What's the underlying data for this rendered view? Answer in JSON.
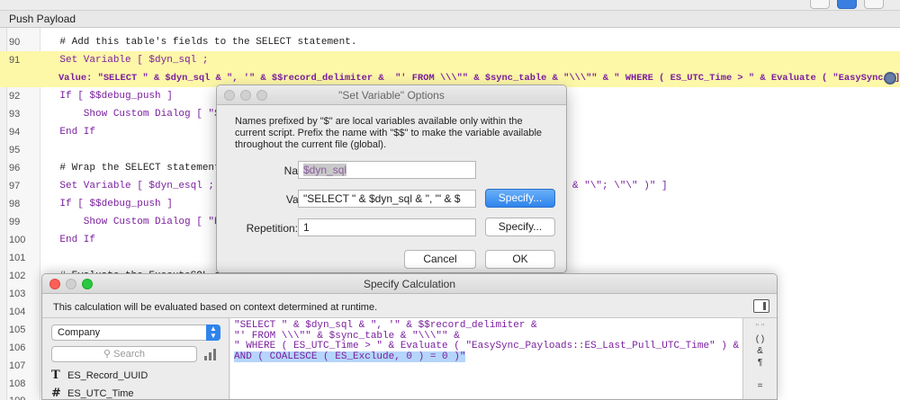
{
  "window": {
    "tab_title": "Push Payload"
  },
  "script_lines": [
    {
      "num": "90",
      "text": "    # Add this table's fields to the SELECT statement.",
      "kind": "comment"
    },
    {
      "num": "91",
      "text": "    Set Variable [ $dyn_sql ;",
      "kind": "step",
      "highlight": true
    },
    {
      "num": "",
      "text": "    Value: \"SELECT \" & $dyn_sql & \", '\" & $$record_delimiter &  \"' FROM \\\\\\\"\" & $sync_table & \"\\\\\\\"\" & \" WHERE ( ES_UTC_Time > \" & Evaluate ( \"EasySync… ]",
      "kind": "step",
      "highlight": true
    },
    {
      "num": "92",
      "text": "    If [ $$debug_push ]",
      "kind": "step"
    },
    {
      "num": "93",
      "text": "        Show Custom Dialog [ \"SEL",
      "kind": "step"
    },
    {
      "num": "94",
      "text": "    End If",
      "kind": "step"
    },
    {
      "num": "95",
      "text": "",
      "kind": "blank"
    },
    {
      "num": "96",
      "text": "    # Wrap the SELECT statement i",
      "kind": "comment"
    },
    {
      "num": "97",
      "text": "    Set Variable [ $dyn_esql ; Val",
      "kind": "step"
    },
    {
      "num": "98",
      "text": "    If [ $$debug_push ]",
      "kind": "step"
    },
    {
      "num": "99",
      "text": "        Show Custom Dialog [ \"Exe",
      "kind": "step"
    },
    {
      "num": "100",
      "text": "    End If",
      "kind": "step"
    },
    {
      "num": "101",
      "text": "",
      "kind": "blank"
    },
    {
      "num": "102",
      "text": "    # Evaluate the ExecuteSQL sta",
      "kind": "comment"
    },
    {
      "num": "103",
      "text": "",
      "kind": "blank"
    },
    {
      "num": "104",
      "text": "",
      "kind": "blank"
    },
    {
      "num": "105",
      "text": "",
      "kind": "blank"
    },
    {
      "num": "106",
      "text": "",
      "kind": "blank"
    },
    {
      "num": "107",
      "text": "",
      "kind": "blank"
    },
    {
      "num": "108",
      "text": "",
      "kind": "blank"
    },
    {
      "num": "109",
      "text": "",
      "kind": "blank"
    }
  ],
  "line97_tail": "& \"\\\"; \\\"\\\" )\" ]",
  "set_variable_dialog": {
    "title": "\"Set Variable\" Options",
    "description": "Names prefixed by \"$\" are local variables available only within the current script. Prefix the name with \"$$\" to make the variable available throughout the current file (global).",
    "name_label": "Name:",
    "name_value": "$dyn_sql",
    "value_label": "Value:",
    "value_value": "\"SELECT \" & $dyn_sql & \", '\" & $",
    "repetition_label": "Repetition:",
    "repetition_value": "1",
    "specify_label_1": "Specify...",
    "specify_label_2": "Specify...",
    "cancel_label": "Cancel",
    "ok_label": "OK"
  },
  "specify_calc_dialog": {
    "title": "Specify Calculation",
    "hint": "This calculation will be evaluated based on context determined at runtime.",
    "context_table": "Company",
    "search_placeholder": "Search",
    "fields": [
      {
        "type_icon": "T",
        "name": "ES_Record_UUID"
      },
      {
        "type_icon": "#",
        "name": "ES_UTC_Time"
      }
    ],
    "calc_lines": [
      "\"SELECT \" & $dyn_sql & \", '\" & $$record_delimiter &",
      "\"' FROM \\\\\\\"\" & $sync_table & \"\\\\\\\"\" &",
      "\" WHERE ( ES_UTC_Time > \" & Evaluate ( \"EasySync_Payloads::ES_Last_Pull_UTC_Time\" ) & \" )",
      "AND ( COALESCE ( ES_Exclude, 0 ) = 0 )\""
    ],
    "operators": [
      "\" \"",
      "( )",
      "&",
      "¶",
      "",
      "="
    ]
  }
}
